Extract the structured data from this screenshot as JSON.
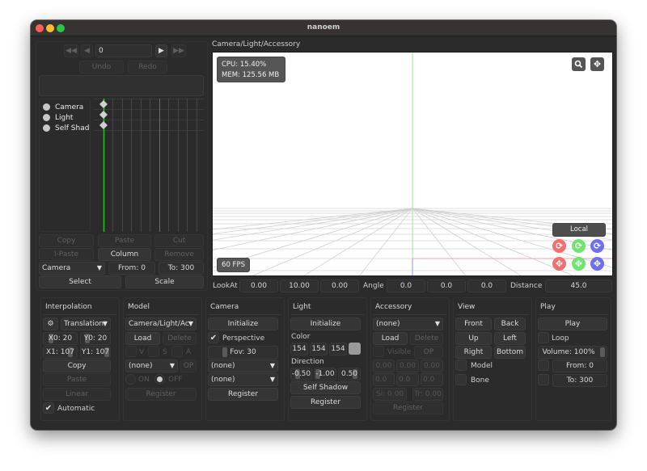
{
  "window": {
    "title": "nanoem"
  },
  "timeline": {
    "frame_value": "0",
    "undo_label": "Undo",
    "redo_label": "Redo",
    "tracks": [
      {
        "label": "Camera"
      },
      {
        "label": "Light"
      },
      {
        "label": "Self Shadow"
      }
    ],
    "copy_label": "Copy",
    "paste_label": "Paste",
    "cut_label": "Cut",
    "ipaste_label": "I-Paste",
    "column_label": "Column",
    "remove_label": "Remove",
    "track_select": "Camera",
    "from_label": "From: 0",
    "to_label": "To: 300",
    "select_label": "Select",
    "scale_label": "Scale"
  },
  "viewport": {
    "header": "Camera/Light/Accessory",
    "cpu": "CPU: 15.40%",
    "mem": "MEM: 125.56 MB",
    "fps": "60 FPS",
    "transform_mode": "Local",
    "colors": {
      "x_axis": "#f46f6f",
      "y_axis": "#6fe46f",
      "z_axis": "#6f6ff0"
    }
  },
  "camera_bar": {
    "lookat_label": "LookAt",
    "lookat": [
      "0.00",
      "10.00",
      "0.00"
    ],
    "angle_label": "Angle",
    "angle": [
      "0.0",
      "0.0",
      "0.0"
    ],
    "distance_label": "Distance",
    "distance": "45.0"
  },
  "interpolation": {
    "title": "Interpolation",
    "type": "Translation",
    "x0": "X0: 20",
    "y0": "Y0: 20",
    "x1": "X1: 107",
    "y1": "Y1: 107",
    "copy_label": "Copy",
    "paste_label": "Paste",
    "linear_label": "Linear",
    "automatic_label": "Automatic",
    "automatic_checked": true
  },
  "model": {
    "title": "Model",
    "selected": "Camera/Light/Ac",
    "load_label": "Load",
    "delete_label": "Delete",
    "v_label": "V",
    "s_label": "S",
    "a_label": "A",
    "bone_select": "(none)",
    "op_label": "OP",
    "on_label": "ON",
    "off_label": "OFF",
    "register_label": "Register"
  },
  "camera": {
    "title": "Camera",
    "initialize_label": "Initialize",
    "perspective_label": "Perspective",
    "perspective_checked": true,
    "fov": "Fov: 30",
    "select1": "(none)",
    "select2": "(none)",
    "register_label": "Register"
  },
  "light": {
    "title": "Light",
    "initialize_label": "Initialize",
    "color_label": "Color",
    "color": [
      "154",
      "154",
      "154"
    ],
    "swatch": "#9a9a9a",
    "direction_label": "Direction",
    "direction": [
      "-0.50",
      "-1.00",
      "0.50"
    ],
    "self_shadow_label": "Self Shadow",
    "register_label": "Register"
  },
  "accessory": {
    "title": "Accessory",
    "selected": "(none)",
    "load_label": "Load",
    "delete_label": "Delete",
    "visible_label": "Visible",
    "op_label": "OP",
    "translation": [
      "0.00",
      "0.00",
      "0.00"
    ],
    "rotation": [
      "0.0",
      "0.0",
      "0.0"
    ],
    "scale": "Si: 0.00",
    "opacity": "Tr: 0.00",
    "register_label": "Register"
  },
  "view": {
    "title": "View",
    "front_label": "Front",
    "back_label": "Back",
    "up_label": "Up",
    "left_label": "Left",
    "right_label": "Right",
    "bottom_label": "Bottom",
    "model_label": "Model",
    "bone_label": "Bone"
  },
  "play": {
    "title": "Play",
    "play_label": "Play",
    "loop_label": "Loop",
    "volume": "Volume: 100%",
    "from": "From: 0",
    "to": "To: 300"
  }
}
